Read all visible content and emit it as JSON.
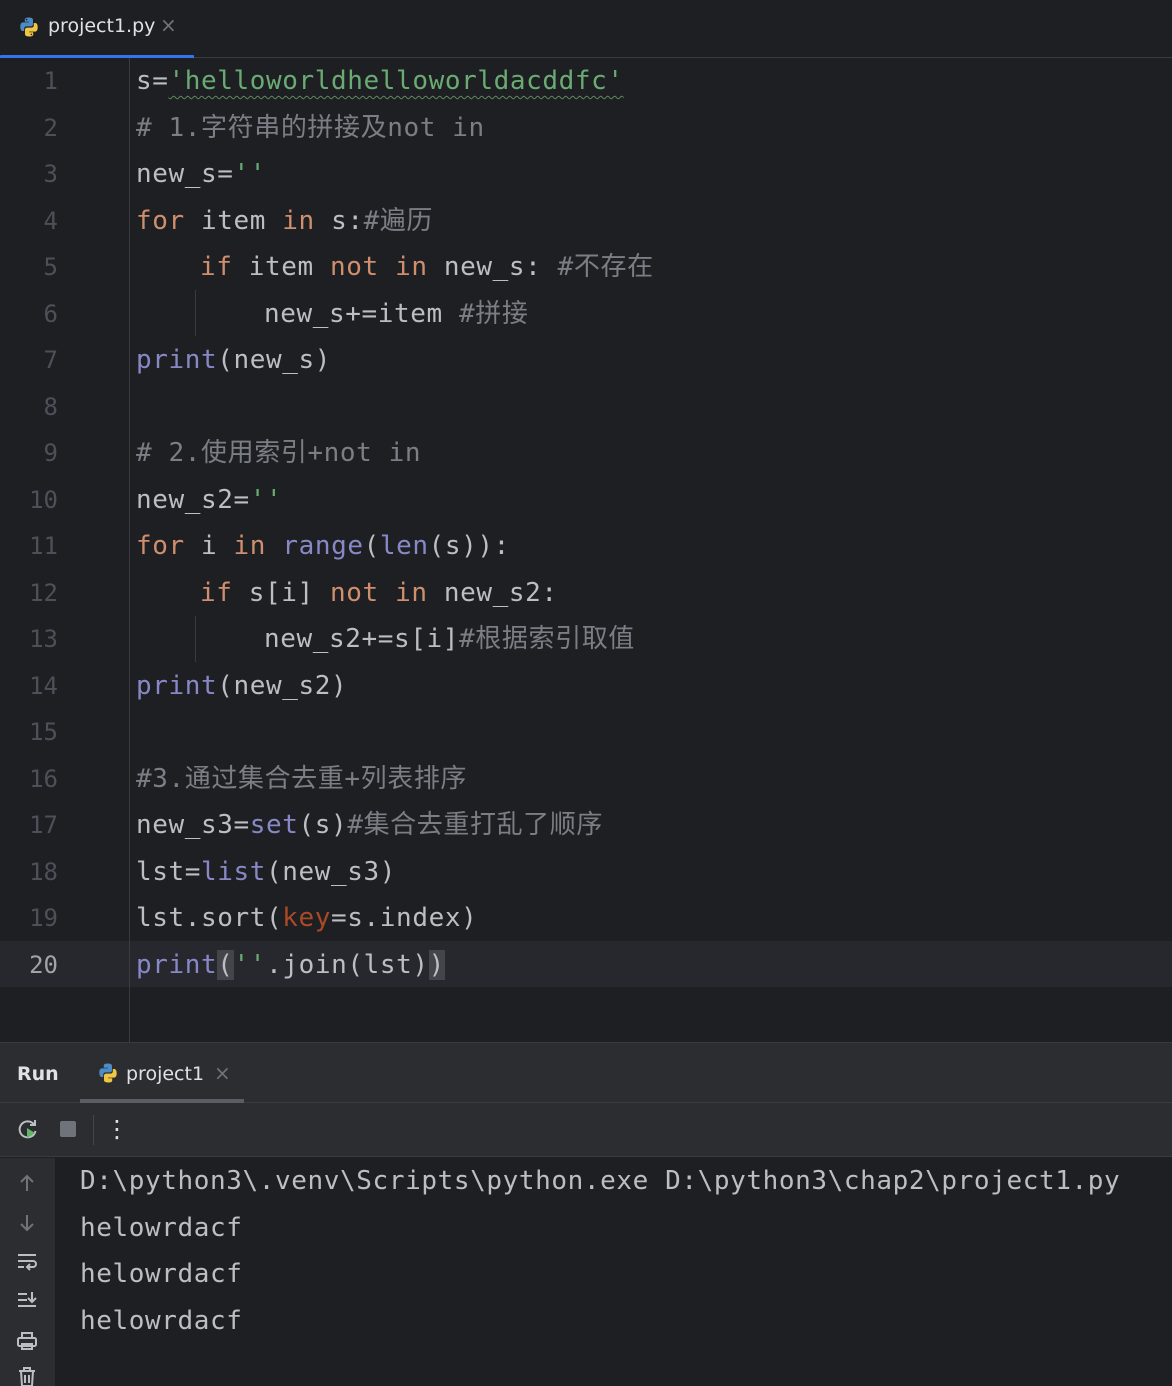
{
  "editor_tab": {
    "filename": "project1.py",
    "close_glyph": "×",
    "icon": "python-file-icon"
  },
  "line_numbers": [
    "1",
    "2",
    "3",
    "4",
    "5",
    "6",
    "7",
    "8",
    "9",
    "10",
    "11",
    "12",
    "13",
    "14",
    "15",
    "16",
    "17",
    "18",
    "19",
    "20"
  ],
  "active_line": "20",
  "code": {
    "l1": {
      "a": "s=",
      "b": "'helloworldhelloworldacddfc'"
    },
    "l2": {
      "a": "# 1.字符串的拼接及not in"
    },
    "l3": {
      "a": "new_s=",
      "b": "''"
    },
    "l4": {
      "a": "for",
      "b": " item ",
      "c": "in",
      "d": " s:",
      "e": "#遍历"
    },
    "l5": {
      "a": "if",
      "b": " item ",
      "c": "not",
      "d": " ",
      "e": "in",
      "f": " new_s: ",
      "g": "#不存在"
    },
    "l6": {
      "a": "new_s+=item ",
      "b": "#拼接"
    },
    "l7": {
      "a": "print",
      "b": "(new_s)"
    },
    "l9": {
      "a": "# 2.使用索引+not in"
    },
    "l10": {
      "a": "new_s2=",
      "b": "''"
    },
    "l11": {
      "a": "for",
      "b": " i ",
      "c": "in",
      "d": " ",
      "e": "range",
      "f": "(",
      "g": "len",
      "h": "(s)):"
    },
    "l12": {
      "a": "if",
      "b": " s[i] ",
      "c": "not",
      "d": " ",
      "e": "in",
      "f": " new_s2:"
    },
    "l13": {
      "a": "new_s2+=s[i]",
      "b": "#根据索引取值"
    },
    "l14": {
      "a": "print",
      "b": "(new_s2)"
    },
    "l16": {
      "a": "#3.通过集合去重+列表排序"
    },
    "l17": {
      "a": "new_s3=",
      "b": "set",
      "c": "(s)",
      "d": "#集合去重打乱了顺序"
    },
    "l18": {
      "a": "lst=",
      "b": "list",
      "c": "(new_s3)"
    },
    "l19": {
      "a": "lst.sort(",
      "b": "key",
      "c": "=s.index)"
    },
    "l20": {
      "a": "print",
      "b": "(",
      "c": "''",
      "d": ".join(lst)",
      "e": ")"
    }
  },
  "run_panel": {
    "title": "Run",
    "tab_label": "project1",
    "tab_close": "×",
    "toolbar": {
      "more_glyph": "⋮"
    },
    "output": [
      "D:\\python3\\.venv\\Scripts\\python.exe D:\\python3\\chap2\\project1.py",
      "helowrdacf",
      "helowrdacf",
      "helowrdacf"
    ]
  },
  "colors": {
    "background": "#1e1f22",
    "panel": "#2b2d30",
    "keyword": "#cf8e6d",
    "string": "#6aab73",
    "comment": "#7a7e85",
    "builtin": "#8888c6",
    "parameter": "#aa4926",
    "accent": "#3574f0"
  }
}
